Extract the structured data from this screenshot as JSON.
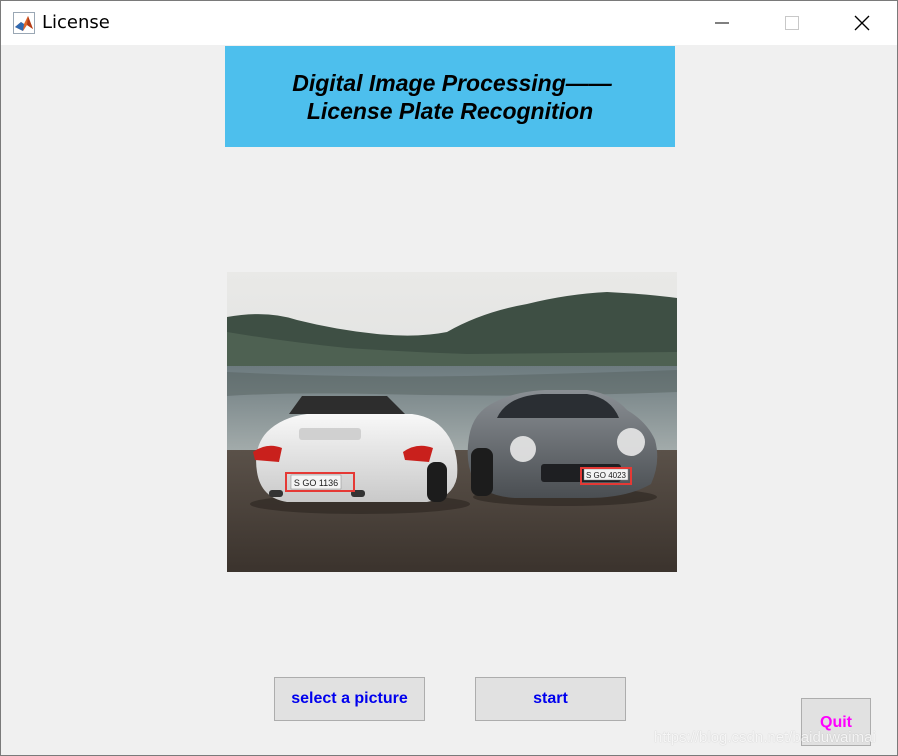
{
  "window": {
    "title": "License",
    "app_icon": "matlab-logo-icon",
    "controls": {
      "minimize": "minimize-icon",
      "maximize": "maximize-icon",
      "close": "close-icon"
    }
  },
  "banner": {
    "line1": "Digital Image Processing——",
    "line2": "License Plate Recognition",
    "background": "#4dbfed"
  },
  "image": {
    "left_plate": "S GO 1136",
    "right_plate": "S GO 4023",
    "highlight_color": "#e53935"
  },
  "buttons": {
    "select": "select a picture",
    "start": "start",
    "quit": "Quit"
  },
  "colors": {
    "button_text": "#0000ee",
    "quit_text": "#ff00ff"
  },
  "watermark": "https://blog.csdn.net/baiduwaimai"
}
